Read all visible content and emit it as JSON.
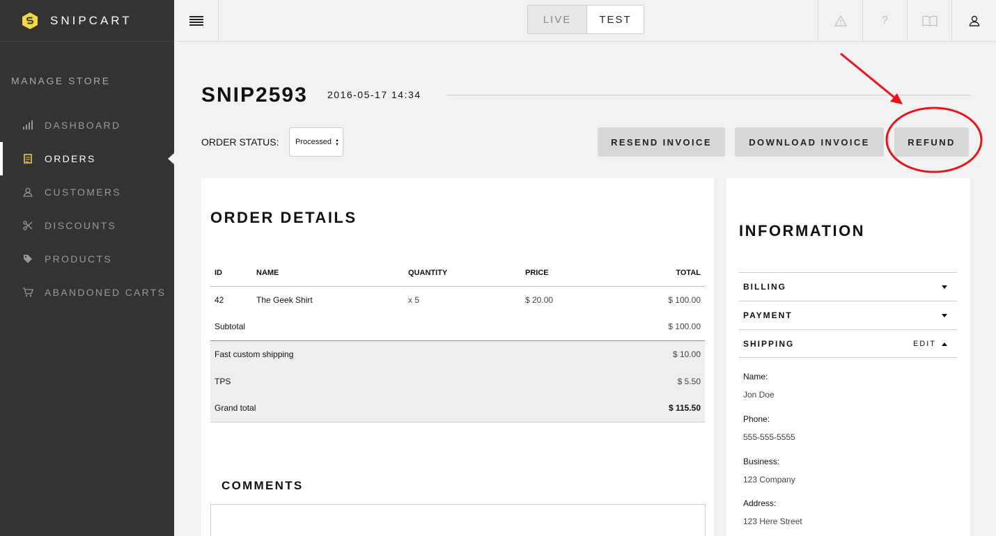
{
  "brand": {
    "name": "SNIPCART"
  },
  "sidebar": {
    "section_title": "MANAGE STORE",
    "items": [
      {
        "label": "DASHBOARD",
        "icon": "bar-chart-icon",
        "active": false
      },
      {
        "label": "ORDERS",
        "icon": "receipt-icon",
        "active": true
      },
      {
        "label": "CUSTOMERS",
        "icon": "user-icon",
        "active": false
      },
      {
        "label": "DISCOUNTS",
        "icon": "scissors-icon",
        "active": false
      },
      {
        "label": "PRODUCTS",
        "icon": "tag-icon",
        "active": false
      },
      {
        "label": "ABANDONED CARTS",
        "icon": "cart-icon",
        "active": false
      }
    ]
  },
  "topbar": {
    "env": {
      "live": "LIVE",
      "test": "TEST",
      "selected": "TEST"
    },
    "icons": [
      "warning-icon",
      "help-icon",
      "docs-book-icon",
      "account-icon"
    ]
  },
  "order": {
    "id": "SNIP2593",
    "date": "2016-05-17 14:34",
    "status_label": "ORDER STATUS:",
    "status_value": "Processed",
    "actions": {
      "resend": "RESEND INVOICE",
      "download": "DOWNLOAD INVOICE",
      "refund": "REFUND"
    }
  },
  "details": {
    "title": "ORDER DETAILS",
    "columns": [
      "ID",
      "NAME",
      "QUANTITY",
      "PRICE",
      "TOTAL"
    ],
    "items": [
      {
        "id": "42",
        "name": "The Geek Shirt",
        "quantity": "x 5",
        "price": "$ 20.00",
        "total": "$ 100.00"
      }
    ],
    "subtotal_label": "Subtotal",
    "subtotal_value": "$ 100.00",
    "shipping_label": "Fast custom shipping",
    "shipping_value": "$ 10.00",
    "tax_label": "TPS",
    "tax_value": "$ 5.50",
    "grand_total_label": "Grand total",
    "grand_total_value": "$ 115.50",
    "comments_title": "COMMENTS"
  },
  "information": {
    "title": "INFORMATION",
    "sections": {
      "billing": "BILLING",
      "payment": "PAYMENT",
      "shipping": "SHIPPING",
      "edit": "EDIT"
    },
    "shipping": {
      "name_label": "Name:",
      "name": "Jon Doe",
      "phone_label": "Phone:",
      "phone": "555-555-5555",
      "business_label": "Business:",
      "business": "123 Company",
      "address_label": "Address:",
      "address": "123 Here Street"
    }
  },
  "colors": {
    "sidebar_bg": "#333333",
    "brand_yellow": "#f3d84a",
    "annotation_red": "#e8141b",
    "button_bg": "#d7d7d7"
  }
}
